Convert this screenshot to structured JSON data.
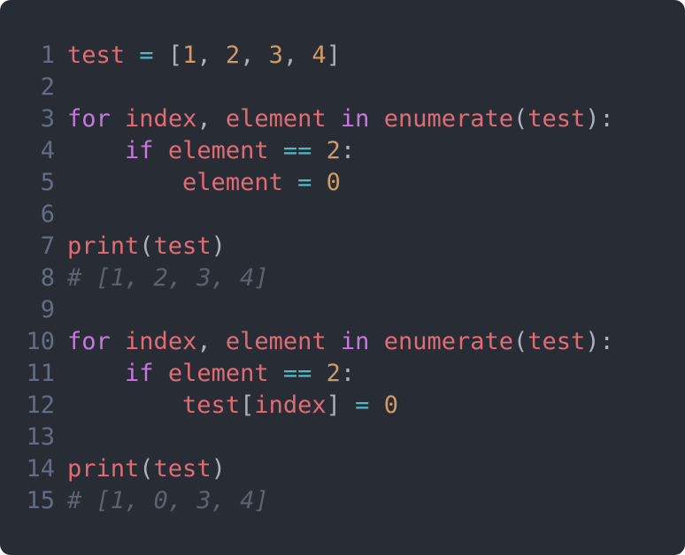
{
  "editor": {
    "language": "python",
    "theme": {
      "background": "#282c34",
      "gutter": "#636d83",
      "variable": "#e06c75",
      "keyword": "#c678dd",
      "operator": "#56b6c2",
      "number": "#d19a66",
      "punctuation": "#abb2bf",
      "comment": "#5c6370"
    },
    "lines": [
      {
        "number": "1",
        "tokens": [
          [
            "var",
            "test"
          ],
          [
            "pun",
            " "
          ],
          [
            "op",
            "="
          ],
          [
            "pun",
            " ["
          ],
          [
            "num",
            "1"
          ],
          [
            "pun",
            ", "
          ],
          [
            "num",
            "2"
          ],
          [
            "pun",
            ", "
          ],
          [
            "num",
            "3"
          ],
          [
            "pun",
            ", "
          ],
          [
            "num",
            "4"
          ],
          [
            "pun",
            "]"
          ]
        ]
      },
      {
        "number": "2",
        "tokens": []
      },
      {
        "number": "3",
        "tokens": [
          [
            "kw",
            "for"
          ],
          [
            "pun",
            " "
          ],
          [
            "var",
            "index"
          ],
          [
            "pun",
            ", "
          ],
          [
            "var",
            "element"
          ],
          [
            "pun",
            " "
          ],
          [
            "kw",
            "in"
          ],
          [
            "pun",
            " "
          ],
          [
            "var",
            "enumerate"
          ],
          [
            "pun",
            "("
          ],
          [
            "var",
            "test"
          ],
          [
            "pun",
            "):"
          ]
        ]
      },
      {
        "number": "4",
        "tokens": [
          [
            "pun",
            "    "
          ],
          [
            "kw",
            "if"
          ],
          [
            "pun",
            " "
          ],
          [
            "var",
            "element"
          ],
          [
            "pun",
            " "
          ],
          [
            "op",
            "=="
          ],
          [
            "pun",
            " "
          ],
          [
            "num",
            "2"
          ],
          [
            "pun",
            ":"
          ]
        ]
      },
      {
        "number": "5",
        "tokens": [
          [
            "pun",
            "        "
          ],
          [
            "var",
            "element"
          ],
          [
            "pun",
            " "
          ],
          [
            "op",
            "="
          ],
          [
            "pun",
            " "
          ],
          [
            "num",
            "0"
          ]
        ]
      },
      {
        "number": "6",
        "tokens": []
      },
      {
        "number": "7",
        "tokens": [
          [
            "var",
            "print"
          ],
          [
            "pun",
            "("
          ],
          [
            "var",
            "test"
          ],
          [
            "pun",
            ")"
          ]
        ]
      },
      {
        "number": "8",
        "tokens": [
          [
            "cmt",
            "# [1, 2, 3, 4]"
          ]
        ]
      },
      {
        "number": "9",
        "tokens": []
      },
      {
        "number": "10",
        "tokens": [
          [
            "kw",
            "for"
          ],
          [
            "pun",
            " "
          ],
          [
            "var",
            "index"
          ],
          [
            "pun",
            ", "
          ],
          [
            "var",
            "element"
          ],
          [
            "pun",
            " "
          ],
          [
            "kw",
            "in"
          ],
          [
            "pun",
            " "
          ],
          [
            "var",
            "enumerate"
          ],
          [
            "pun",
            "("
          ],
          [
            "var",
            "test"
          ],
          [
            "pun",
            "):"
          ]
        ]
      },
      {
        "number": "11",
        "tokens": [
          [
            "pun",
            "    "
          ],
          [
            "kw",
            "if"
          ],
          [
            "pun",
            " "
          ],
          [
            "var",
            "element"
          ],
          [
            "pun",
            " "
          ],
          [
            "op",
            "=="
          ],
          [
            "pun",
            " "
          ],
          [
            "num",
            "2"
          ],
          [
            "pun",
            ":"
          ]
        ]
      },
      {
        "number": "12",
        "tokens": [
          [
            "pun",
            "        "
          ],
          [
            "var",
            "test"
          ],
          [
            "pun",
            "["
          ],
          [
            "var",
            "index"
          ],
          [
            "pun",
            "]"
          ],
          [
            "pun",
            " "
          ],
          [
            "op",
            "="
          ],
          [
            "pun",
            " "
          ],
          [
            "num",
            "0"
          ]
        ]
      },
      {
        "number": "13",
        "tokens": []
      },
      {
        "number": "14",
        "tokens": [
          [
            "var",
            "print"
          ],
          [
            "pun",
            "("
          ],
          [
            "var",
            "test"
          ],
          [
            "pun",
            ")"
          ]
        ]
      },
      {
        "number": "15",
        "tokens": [
          [
            "cmt",
            "# [1, 0, 3, 4]"
          ]
        ]
      }
    ]
  }
}
